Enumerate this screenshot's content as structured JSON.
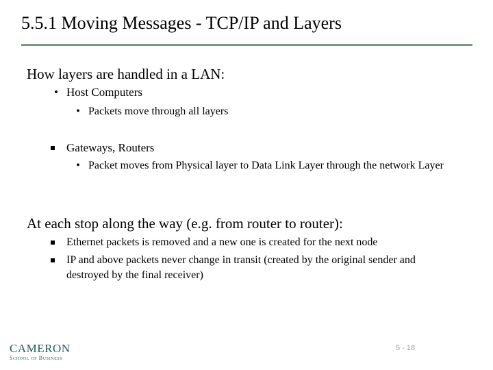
{
  "slide": {
    "title": "5.5.1  Moving Messages - TCP/IP and Layers",
    "colors": {
      "rule": "#7a9a80",
      "logo": "#1f5d5c",
      "page_number": "#9a9a9a"
    },
    "sections": [
      {
        "heading": "How layers are handled in a LAN:",
        "items": [
          {
            "bullet": "•",
            "text": "Host Computers",
            "subitems": [
              {
                "bullet": "•",
                "text": "Packets move through all layers"
              }
            ]
          },
          {
            "bullet": "square",
            "text": "Gateways, Routers",
            "subitems": [
              {
                "bullet": "•",
                "text": "Packet moves from Physical layer to Data Link Layer through the network Layer"
              }
            ]
          }
        ]
      },
      {
        "heading": "At each stop along the way (e.g. from router to router):",
        "items": [
          {
            "bullet": "square",
            "text": "Ethernet packets is removed and a new one is created for the next node"
          },
          {
            "bullet": "square",
            "text": "IP and above packets never change in transit (created by the original sender and destroyed by the final receiver)"
          }
        ]
      }
    ],
    "footer": {
      "logo_main": "CAMERON",
      "logo_sub": "School of Business",
      "page_number": "5 - 18"
    }
  }
}
